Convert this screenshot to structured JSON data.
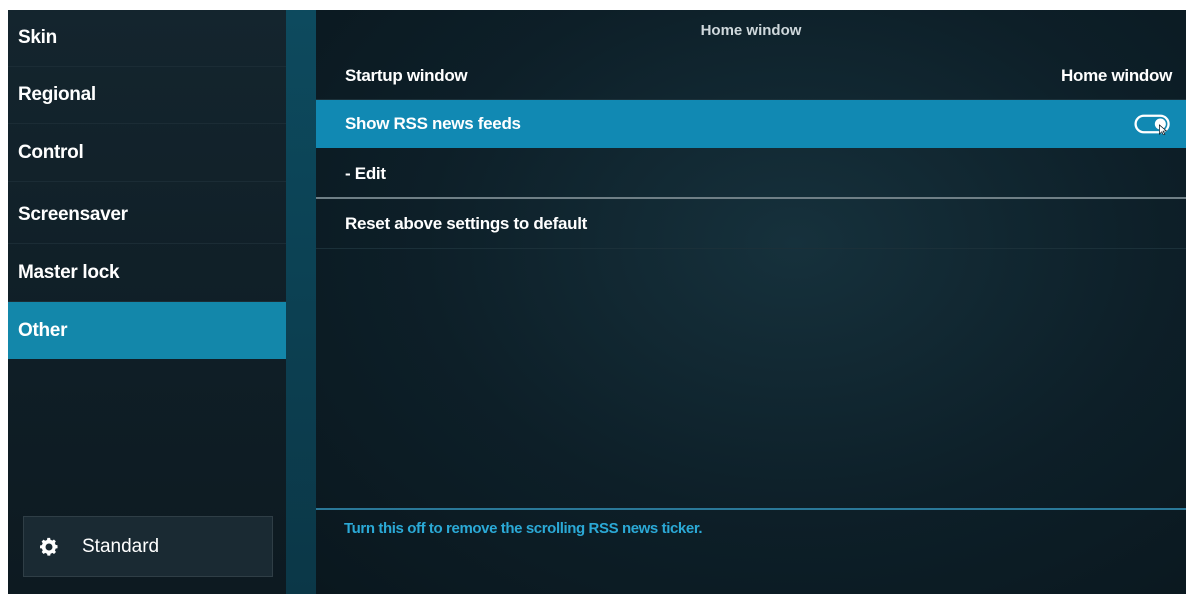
{
  "sidebar": {
    "items": [
      {
        "label": "Skin"
      },
      {
        "label": "Regional"
      },
      {
        "label": "Control"
      },
      {
        "label": "Screensaver"
      },
      {
        "label": "Master lock"
      },
      {
        "label": "Other"
      }
    ],
    "active_index": 5,
    "level_button": {
      "label": "Standard",
      "icon": "gear-icon"
    }
  },
  "main": {
    "section_header": "Home window",
    "settings": [
      {
        "label": "Startup window",
        "value": "Home window"
      },
      {
        "label": "Show RSS news feeds",
        "toggle_on": true
      },
      {
        "label": "- Edit"
      },
      {
        "label": "Reset above settings to default"
      }
    ],
    "hint": "Turn this off to remove the scrolling RSS news ticker."
  },
  "colors": {
    "accent": "#1189b3",
    "sidebar_active": "#1387aa",
    "hint_text": "#2ba9d6"
  }
}
